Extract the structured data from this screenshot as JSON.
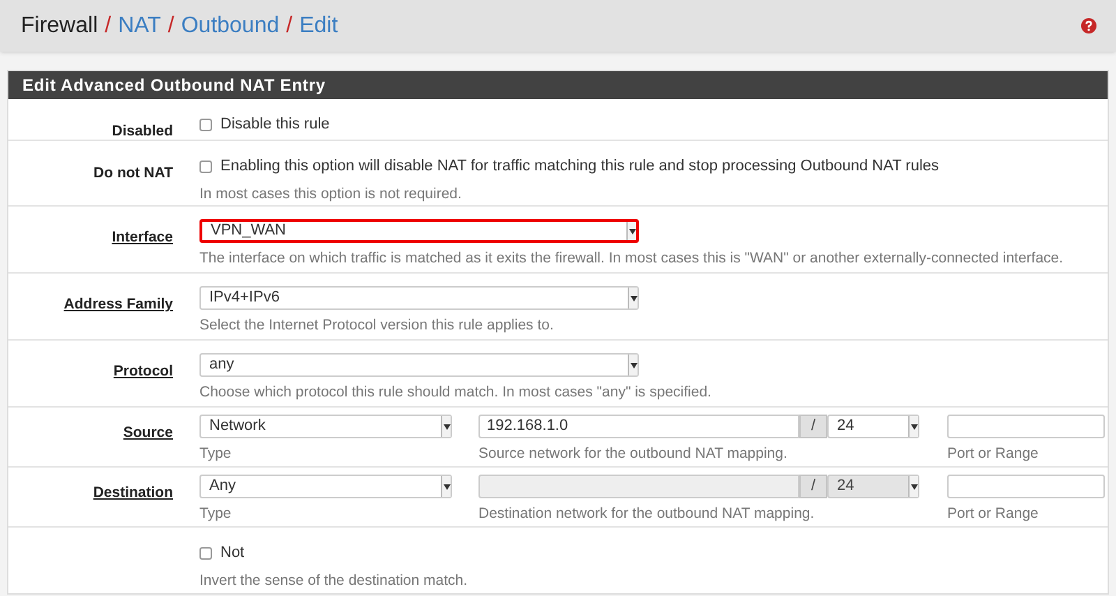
{
  "breadcrumb": [
    {
      "label": "Firewall",
      "kind": "text"
    },
    {
      "label": "NAT",
      "kind": "link"
    },
    {
      "label": "Outbound",
      "kind": "link"
    },
    {
      "label": "Edit",
      "kind": "link"
    }
  ],
  "breadcrumb_separator": "/",
  "panel": {
    "title": "Edit Advanced Outbound NAT Entry"
  },
  "rows": [
    {
      "kind": "checkbox",
      "label": "Disabled",
      "link": false,
      "checkbox": {
        "label": "Disable this rule",
        "checked": false
      }
    },
    {
      "kind": "checkbox",
      "label": "Do not NAT",
      "link": false,
      "checkbox": {
        "label": "Enabling this option will disable NAT for traffic matching this rule and stop processing Outbound NAT rules",
        "checked": false
      },
      "help": "In most cases this option is not required."
    },
    {
      "kind": "select",
      "label": "Interface",
      "link": true,
      "value": "VPN_WAN",
      "highlighted": true,
      "help": "The interface on which traffic is matched as it exits the firewall. In most cases this is \"WAN\" or another externally-connected interface."
    },
    {
      "kind": "select",
      "label": "Address Family",
      "link": true,
      "value": "IPv4+IPv6",
      "highlighted": false,
      "help": "Select the Internet Protocol version this rule applies to."
    },
    {
      "kind": "select",
      "label": "Protocol",
      "link": true,
      "value": "any",
      "highlighted": false,
      "help": "Choose which protocol this rule should match. In most cases \"any\" is specified."
    },
    {
      "kind": "address",
      "label": "Source",
      "link": true,
      "type": {
        "value": "Network",
        "caption": "Type"
      },
      "network": {
        "value": "192.168.1.0",
        "disabled": false,
        "caption": "Source network for the outbound NAT mapping."
      },
      "separator": "/",
      "mask": {
        "value": "24",
        "disabled": false
      },
      "port": {
        "caption": "Port or Range"
      }
    },
    {
      "kind": "address",
      "label": "Destination",
      "link": true,
      "type": {
        "value": "Any",
        "caption": "Type"
      },
      "network": {
        "disabled": true,
        "caption": "Destination network for the outbound NAT mapping."
      },
      "separator": "/",
      "mask": {
        "value": "24",
        "disabled": true
      },
      "port": {
        "caption": "Port or Range"
      }
    },
    {
      "kind": "checkbox",
      "checkbox": {
        "label": "Not",
        "checked": false
      },
      "help": "Invert the sense of the destination match."
    }
  ]
}
